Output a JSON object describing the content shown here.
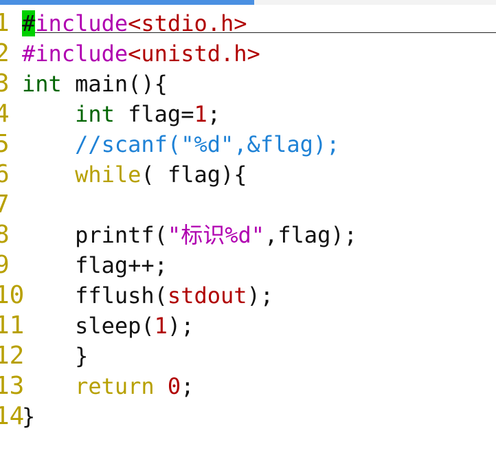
{
  "editor": {
    "title_bar_visible": true,
    "colors": {
      "preprocessor": "#b000b0",
      "header": "#b00000",
      "type": "#006400",
      "keyword": "#b7a000",
      "comment": "#1f82d6",
      "string": "#b000b0",
      "number": "#b00000",
      "plain": "#111111",
      "gutter": "#b8a000",
      "cursor": "#00d000"
    },
    "lines": [
      {
        "number": "1",
        "tokens": [
          {
            "text": "#",
            "class": "cursor"
          },
          {
            "text": "include",
            "class": "preprocessor"
          },
          {
            "text": "<stdio.h>",
            "class": "header"
          }
        ]
      },
      {
        "number": "2",
        "tokens": [
          {
            "text": "#include",
            "class": "preprocessor"
          },
          {
            "text": "<unistd.h>",
            "class": "header"
          }
        ]
      },
      {
        "number": "3",
        "tokens": [
          {
            "text": "int",
            "class": "type"
          },
          {
            "text": " main(){",
            "class": "plain"
          }
        ]
      },
      {
        "number": "4",
        "tokens": [
          {
            "text": "    ",
            "class": "plain"
          },
          {
            "text": "int",
            "class": "type"
          },
          {
            "text": " flag=",
            "class": "plain"
          },
          {
            "text": "1",
            "class": "number"
          },
          {
            "text": ";",
            "class": "plain"
          }
        ]
      },
      {
        "number": "5",
        "tokens": [
          {
            "text": "    ",
            "class": "plain"
          },
          {
            "text": "//scanf(\"%d\",&flag);",
            "class": "comment"
          }
        ]
      },
      {
        "number": "6",
        "tokens": [
          {
            "text": "    ",
            "class": "plain"
          },
          {
            "text": "while",
            "class": "keyword"
          },
          {
            "text": "( flag){",
            "class": "plain"
          }
        ]
      },
      {
        "number": "7",
        "tokens": []
      },
      {
        "number": "8",
        "tokens": [
          {
            "text": "    printf(",
            "class": "plain"
          },
          {
            "text": "\"标识%d\"",
            "class": "string"
          },
          {
            "text": ",flag);",
            "class": "plain"
          }
        ]
      },
      {
        "number": "9",
        "tokens": [
          {
            "text": "    flag++;",
            "class": "plain"
          }
        ]
      },
      {
        "number": "10",
        "tokens": [
          {
            "text": "    fflush(",
            "class": "plain"
          },
          {
            "text": "stdout",
            "class": "header"
          },
          {
            "text": ");",
            "class": "plain"
          }
        ]
      },
      {
        "number": "11",
        "tokens": [
          {
            "text": "    sleep(",
            "class": "plain"
          },
          {
            "text": "1",
            "class": "number"
          },
          {
            "text": ");",
            "class": "plain"
          }
        ]
      },
      {
        "number": "12",
        "tokens": [
          {
            "text": "    }",
            "class": "plain"
          }
        ]
      },
      {
        "number": "13",
        "tokens": [
          {
            "text": "    ",
            "class": "plain"
          },
          {
            "text": "return",
            "class": "keyword"
          },
          {
            "text": " ",
            "class": "plain"
          },
          {
            "text": "0",
            "class": "number"
          },
          {
            "text": ";",
            "class": "plain"
          }
        ]
      },
      {
        "number": "14",
        "tokens": [
          {
            "text": "}",
            "class": "plain"
          }
        ]
      }
    ]
  }
}
